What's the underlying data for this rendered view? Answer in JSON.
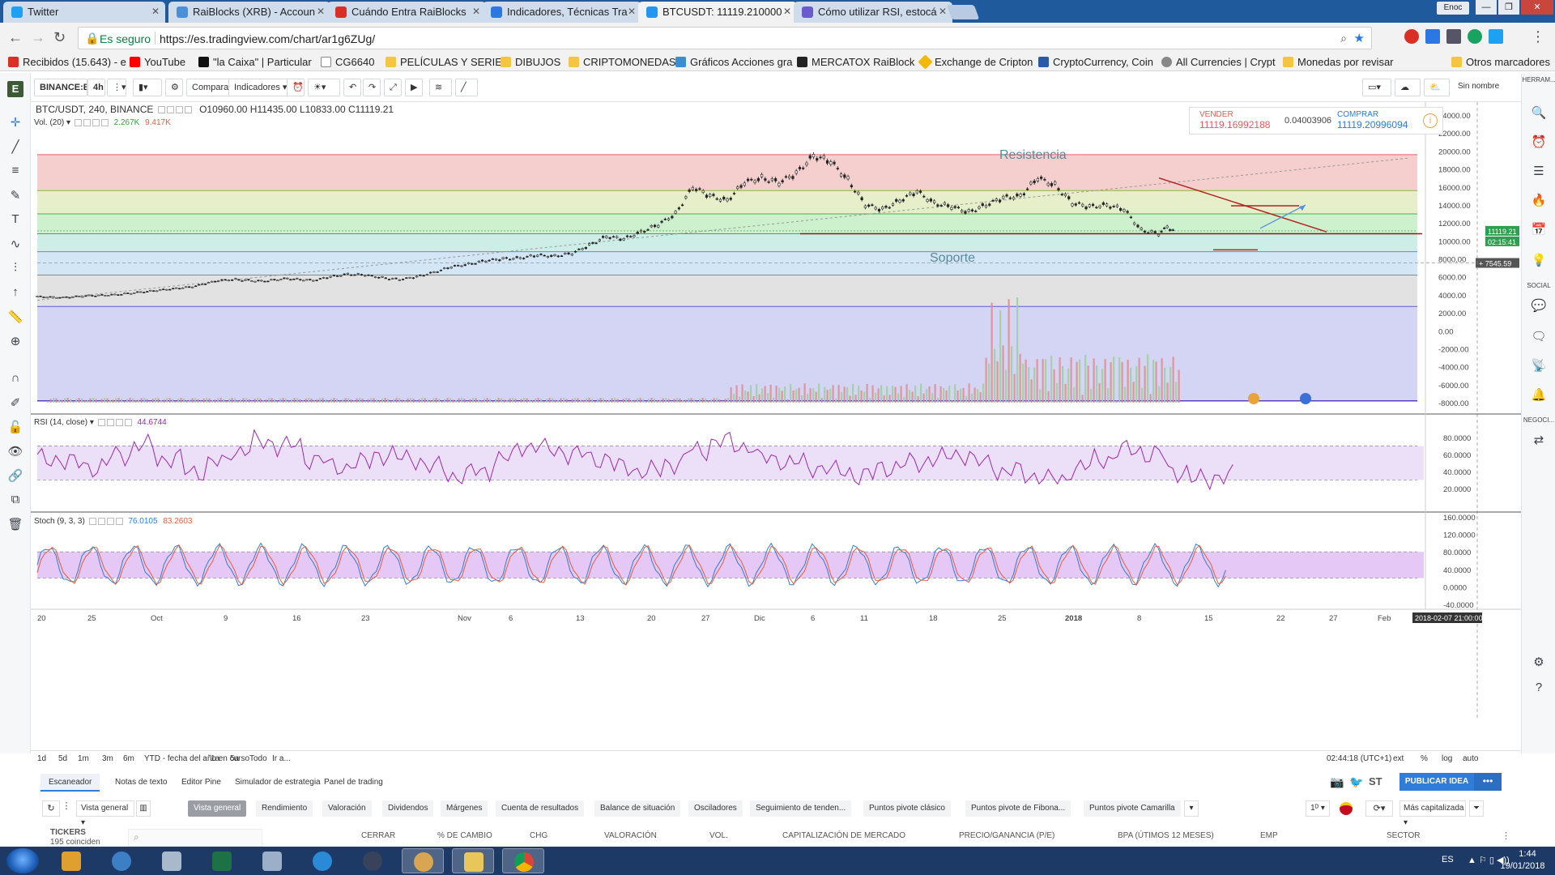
{
  "browser": {
    "tabs": [
      {
        "title": "Twitter",
        "fav": "#1da1f2"
      },
      {
        "title": "RaiBlocks (XRB) - Accoun",
        "fav": "#4a90d9"
      },
      {
        "title": "Cuándo Entra RaiBlocks",
        "fav": "#d93025"
      },
      {
        "title": "Indicadores, Técnicas Tra",
        "fav": "#2b78e4"
      },
      {
        "title": "BTCUSDT: 11119.210000",
        "fav": "#2196f3"
      },
      {
        "title": "Cómo utilizar RSI, estocá",
        "fav": "#6a5acd"
      }
    ],
    "window_user": "Enoc",
    "secure_label": "Es seguro",
    "url": "https://es.tradingview.com/chart/ar1g6ZUg/",
    "bookmarks": [
      "Recibidos (15.643) - e",
      "YouTube",
      "\"la Caixa\" | Particular",
      "CG6640",
      "PELÍCULAS Y SERIES",
      "DIBUJOS",
      "CRIPTOMONEDAS",
      "Gráficos Acciones gra",
      "MERCATOX RaiBlock",
      "Exchange de Cripton",
      "CryptoCurrency, Coin",
      "All Currencies | Crypt",
      "Monedas por revisar",
      "Otros marcadores"
    ]
  },
  "toolbar": {
    "symbol": "BINANCE:BTCUS",
    "interval": "4h",
    "compare": "Comparar",
    "indicators": "Indicadores",
    "sin_nombre": "Sin nombre"
  },
  "legend": {
    "main": "BTC/USDT, 240, BINANCE",
    "ohlc": "O10960.00  H11435.00  L10833.00  C11119.21",
    "vol_label": "Vol. (20)",
    "vol_values": [
      "2.267K",
      "9.417K"
    ],
    "rsi_label": "RSI (14, close)",
    "rsi_value": "44.6744",
    "stoch_label": "Stoch (9, 3, 3)",
    "stoch_values": [
      "76.0105",
      "83.2603"
    ]
  },
  "trade": {
    "sell_label": "VENDER",
    "sell_price": "11119.16992188",
    "spread": "0.04003906",
    "buy_label": "COMPRAR",
    "buy_price": "11119.20996094"
  },
  "annotations": {
    "resistance": "Resistencia",
    "support": "Soporte"
  },
  "price_axis": [
    "24000.00",
    "22000.00",
    "20000.00",
    "18000.00",
    "16000.00",
    "14000.00",
    "12000.00",
    "10000.00",
    "8000.00",
    "6000.00",
    "4000.00",
    "2000.00",
    "0.00",
    "-2000.00",
    "-4000.00",
    "-6000.00",
    "-8000.00"
  ],
  "price_tags": {
    "last": "11119.21",
    "countdown": "02:15:41",
    "cursor": "7545.59"
  },
  "rsi_axis": [
    "80.0000",
    "60.0000",
    "40.0000",
    "20.0000"
  ],
  "stoch_axis": [
    "160.0000",
    "120.0000",
    "80.0000",
    "40.0000",
    "0.0000",
    "-40.0000"
  ],
  "time_axis": [
    "20",
    "25",
    "Oct",
    "9",
    "16",
    "23",
    "Nov",
    "6",
    "13",
    "20",
    "27",
    "Dic",
    "11",
    "18",
    "25",
    "2018",
    "8",
    "15",
    "22",
    "Feb",
    "Feb"
  ],
  "time_axis_real": [
    "20",
    "25",
    "Oct",
    "9",
    "16",
    "23",
    "Nov",
    "6",
    "13",
    "20",
    "27",
    "Dic",
    "6",
    "11",
    "18",
    "25",
    "2018",
    "8",
    "15",
    "22",
    "27",
    "Feb"
  ],
  "time_cursor": "2018-02-07 21:00:00",
  "ranges": [
    "1d",
    "5d",
    "1m",
    "3m",
    "6m",
    "YTD - fecha del año en curso",
    "1a",
    "5a",
    "Todo",
    "Ir a..."
  ],
  "status": {
    "clock": "02:44:18 (UTC+1)",
    "ext": "ext",
    "pct": "%",
    "log": "log",
    "auto": "auto"
  },
  "bottom": {
    "tabs": [
      "Escaneador",
      "Notas de texto",
      "Editor Pine",
      "Simulador de estrategia",
      "Panel de trading"
    ],
    "publish": "PUBLICAR IDEA",
    "view_select": "Vista general",
    "chips": [
      "Vista general",
      "Rendimiento",
      "Valoración",
      "Dividendos",
      "Márgenes",
      "Cuenta de resultados",
      "Balance de situación",
      "Osciladores",
      "Seguimiento de tenden...",
      "Puntos pivote clásico",
      "Puntos pivote de Fibona...",
      "Puntos pivote Camarilla"
    ],
    "right_select": "Más capitalizada",
    "tickers": "TICKERS",
    "match": "195 coinciden",
    "columns": [
      "CERRAR",
      "% DE CAMBIO",
      "CHG",
      "VALORACIÓN",
      "VOL.",
      "CAPITALIZACIÓN DE MERCADO",
      "PRECIO/GANANCIA (P/E)",
      "BPA (ÚTIMOS 12 MESES)",
      "EMP",
      "SECTOR"
    ]
  },
  "side_labels": {
    "herram": "HERRAM...",
    "social": "SOCIAL",
    "negoci": "NEGOCI..."
  },
  "taskbar": {
    "lang": "ES",
    "time": "1:44",
    "date": "19/01/2018"
  },
  "chart_data": {
    "type": "candlestick",
    "symbol": "BTC/USDT",
    "interval": "240",
    "last_close": 11119.21,
    "fib_levels": [
      19600,
      15600,
      13000,
      10800,
      8800,
      6200,
      2700
    ],
    "support": 10800,
    "resistance_label": "Resistencia",
    "support_label": "Soporte",
    "close_path": [
      [
        0,
        3800
      ],
      [
        30,
        3700
      ],
      [
        60,
        3900
      ],
      [
        90,
        4000
      ],
      [
        120,
        4300
      ],
      [
        150,
        4600
      ],
      [
        180,
        4900
      ],
      [
        210,
        5600
      ],
      [
        230,
        5700
      ],
      [
        260,
        5500
      ],
      [
        290,
        5800
      ],
      [
        320,
        5600
      ],
      [
        340,
        6000
      ],
      [
        360,
        6300
      ],
      [
        380,
        6200
      ],
      [
        400,
        5900
      ],
      [
        420,
        5700
      ],
      [
        440,
        6000
      ],
      [
        460,
        6500
      ],
      [
        480,
        7100
      ],
      [
        500,
        7400
      ],
      [
        520,
        7800
      ],
      [
        540,
        8000
      ],
      [
        560,
        8100
      ],
      [
        580,
        8400
      ],
      [
        600,
        8300
      ],
      [
        620,
        8600
      ],
      [
        640,
        9500
      ],
      [
        660,
        10500
      ],
      [
        680,
        10200
      ],
      [
        700,
        11000
      ],
      [
        720,
        11800
      ],
      [
        740,
        13000
      ],
      [
        760,
        16000
      ],
      [
        780,
        15000
      ],
      [
        800,
        14500
      ],
      [
        820,
        16500
      ],
      [
        840,
        17000
      ],
      [
        860,
        16500
      ],
      [
        880,
        17500
      ],
      [
        900,
        19500
      ],
      [
        920,
        18800
      ],
      [
        940,
        16800
      ],
      [
        960,
        14000
      ],
      [
        980,
        13500
      ],
      [
        1000,
        14500
      ],
      [
        1020,
        15500
      ],
      [
        1040,
        14200
      ],
      [
        1060,
        13800
      ],
      [
        1080,
        13200
      ],
      [
        1100,
        14000
      ],
      [
        1120,
        14800
      ],
      [
        1140,
        15000
      ],
      [
        1160,
        17000
      ],
      [
        1180,
        16200
      ],
      [
        1200,
        14200
      ],
      [
        1220,
        13800
      ],
      [
        1240,
        14000
      ],
      [
        1260,
        13500
      ],
      [
        1280,
        11200
      ],
      [
        1300,
        10800
      ],
      [
        1310,
        11500
      ],
      [
        1320,
        11119
      ]
    ],
    "rsi_values": [
      55,
      50,
      45,
      60,
      70,
      55,
      40,
      50,
      65,
      75,
      70,
      55,
      45,
      50,
      60,
      55,
      45,
      35,
      40,
      55,
      70,
      65,
      60,
      55,
      45,
      40,
      50,
      65,
      75,
      70,
      55,
      50,
      45,
      40,
      35,
      45,
      50,
      55,
      60,
      50,
      40,
      35,
      30,
      45,
      55,
      65,
      60,
      40,
      30,
      35,
      45
    ],
    "stoch_oscillates": true
  }
}
